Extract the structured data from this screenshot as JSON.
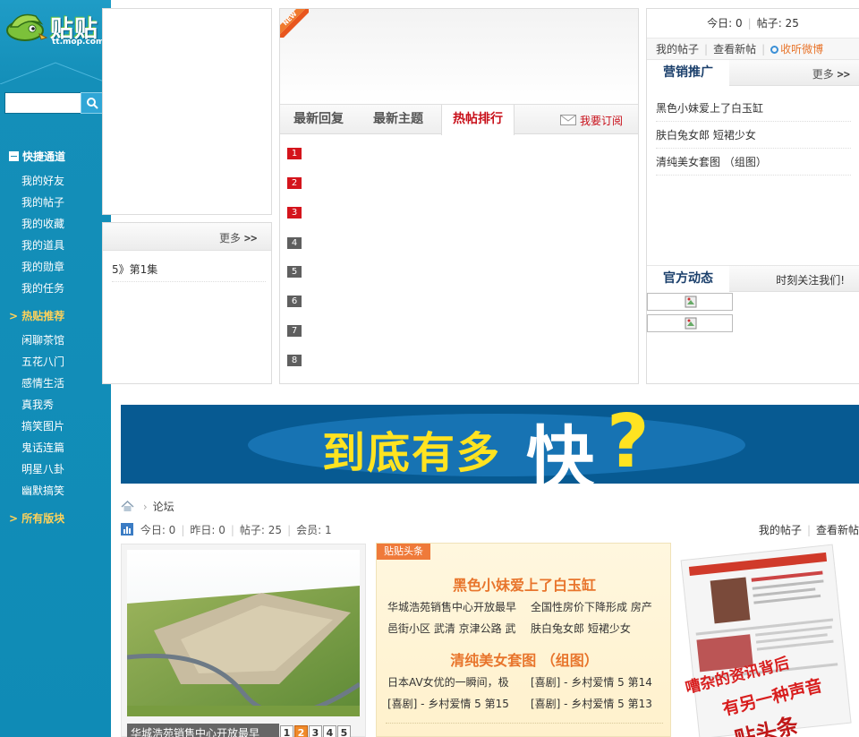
{
  "sidebar": {
    "logo_text": "贴贴",
    "logo_sub": "tt.mop.com",
    "search_placeholder": "",
    "sections": [
      {
        "label": "快捷通道",
        "items": [
          "我的好友",
          "我的帖子",
          "我的收藏",
          "我的道具",
          "我的勋章",
          "我的任务"
        ]
      },
      {
        "label": "> 热贴推荐",
        "items": [
          "闲聊茶馆",
          "五花八门",
          "感情生活",
          "真我秀",
          "搞笑图片",
          "鬼话连篇",
          "明星八卦",
          "幽默搞笑"
        ]
      },
      {
        "label": "> 所有版块",
        "items": []
      }
    ]
  },
  "left_panel": {
    "more_label": "更多",
    "more_arrows": ">>",
    "item": "5》第1集"
  },
  "center_panel": {
    "new_badge": "NEW",
    "tabs": [
      "最新回复",
      "最新主题",
      "热帖排行"
    ],
    "active_tab": 2,
    "subscribe_label": "我要订阅",
    "ranks": [
      "1",
      "2",
      "3",
      "4",
      "5",
      "6",
      "7",
      "8"
    ]
  },
  "right_panel": {
    "today_label": "今日: 0",
    "posts_label": "帖子: 25",
    "links": [
      "我的帖子",
      "查看新帖",
      "收听微博"
    ],
    "marketing_title": "营销推广",
    "more_label": "更多",
    "more_arrows": ">>",
    "marketing_items": [
      "黑色小妹爱上了白玉缸",
      "肤白兔女郎 短裙少女",
      "清纯美女套图 （组图）"
    ],
    "official_title": "官方动态",
    "official_follow": "时刻关注我们!"
  },
  "banner": {
    "text1": "到底有多",
    "text2": "快",
    "text3": "?"
  },
  "breadcrumb": {
    "label": "论坛"
  },
  "stats": {
    "today": "今日: 0",
    "yesterday": "昨日: 0",
    "posts": "帖子: 25",
    "members": "会员: 1",
    "my_posts": "我的帖子",
    "new_posts": "查看新帖"
  },
  "photo": {
    "caption": "华城浩苑销售中心开放最早",
    "pages": [
      "1",
      "2",
      "3",
      "4",
      "5"
    ],
    "active_page": 1
  },
  "headlines": {
    "tag": "贴贴头条",
    "big1": "黑色小妹爱上了白玉缸",
    "row1": [
      "华城浩苑销售中心开放最早",
      "全国性房价下降形成 房产"
    ],
    "row2": [
      "邑街小区 武清 京津公路 武",
      "肤白兔女郎 短裙少女"
    ],
    "big2": "清纯美女套图 （组图）",
    "row3": [
      "日本AV女优的一瞬间，极",
      "[喜剧] - 乡村爱情 5 第14"
    ],
    "row4": [
      "[喜剧] - 乡村爱情 5 第15",
      "[喜剧] - 乡村爱情 5 第13"
    ]
  },
  "right_image": {
    "text1": "嘈杂的资讯背后",
    "text2": "有另一种声音",
    "text3": "贴头条"
  },
  "colors": {
    "sidebar": "#148fb9",
    "accent_red": "#c8101a",
    "banner_bg": "#075a92",
    "banner_yellow": "#ffe321",
    "headline_orange": "#e8752c"
  }
}
